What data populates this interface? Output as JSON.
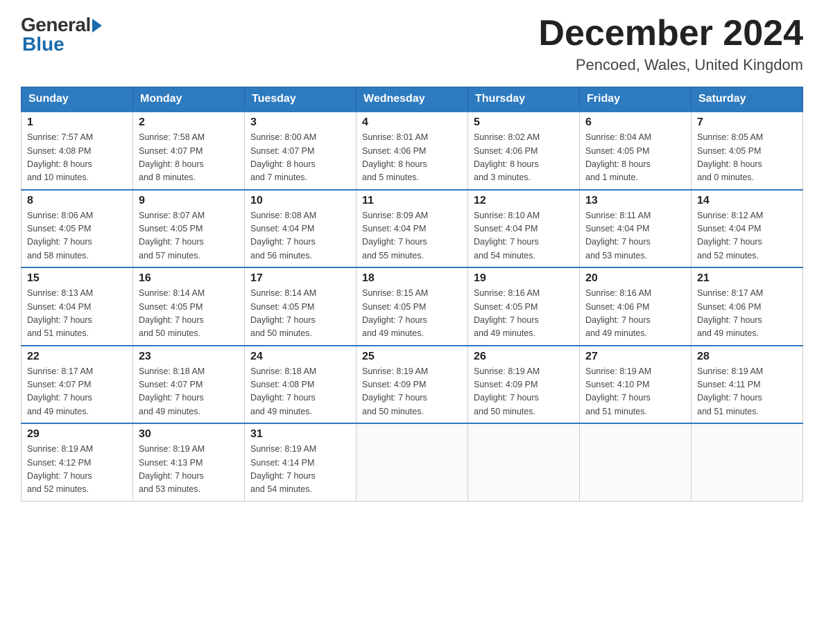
{
  "logo": {
    "general": "General",
    "blue": "Blue"
  },
  "title": "December 2024",
  "subtitle": "Pencoed, Wales, United Kingdom",
  "days_of_week": [
    "Sunday",
    "Monday",
    "Tuesday",
    "Wednesday",
    "Thursday",
    "Friday",
    "Saturday"
  ],
  "weeks": [
    [
      {
        "day": "1",
        "info": "Sunrise: 7:57 AM\nSunset: 4:08 PM\nDaylight: 8 hours\nand 10 minutes."
      },
      {
        "day": "2",
        "info": "Sunrise: 7:58 AM\nSunset: 4:07 PM\nDaylight: 8 hours\nand 8 minutes."
      },
      {
        "day": "3",
        "info": "Sunrise: 8:00 AM\nSunset: 4:07 PM\nDaylight: 8 hours\nand 7 minutes."
      },
      {
        "day": "4",
        "info": "Sunrise: 8:01 AM\nSunset: 4:06 PM\nDaylight: 8 hours\nand 5 minutes."
      },
      {
        "day": "5",
        "info": "Sunrise: 8:02 AM\nSunset: 4:06 PM\nDaylight: 8 hours\nand 3 minutes."
      },
      {
        "day": "6",
        "info": "Sunrise: 8:04 AM\nSunset: 4:05 PM\nDaylight: 8 hours\nand 1 minute."
      },
      {
        "day": "7",
        "info": "Sunrise: 8:05 AM\nSunset: 4:05 PM\nDaylight: 8 hours\nand 0 minutes."
      }
    ],
    [
      {
        "day": "8",
        "info": "Sunrise: 8:06 AM\nSunset: 4:05 PM\nDaylight: 7 hours\nand 58 minutes."
      },
      {
        "day": "9",
        "info": "Sunrise: 8:07 AM\nSunset: 4:05 PM\nDaylight: 7 hours\nand 57 minutes."
      },
      {
        "day": "10",
        "info": "Sunrise: 8:08 AM\nSunset: 4:04 PM\nDaylight: 7 hours\nand 56 minutes."
      },
      {
        "day": "11",
        "info": "Sunrise: 8:09 AM\nSunset: 4:04 PM\nDaylight: 7 hours\nand 55 minutes."
      },
      {
        "day": "12",
        "info": "Sunrise: 8:10 AM\nSunset: 4:04 PM\nDaylight: 7 hours\nand 54 minutes."
      },
      {
        "day": "13",
        "info": "Sunrise: 8:11 AM\nSunset: 4:04 PM\nDaylight: 7 hours\nand 53 minutes."
      },
      {
        "day": "14",
        "info": "Sunrise: 8:12 AM\nSunset: 4:04 PM\nDaylight: 7 hours\nand 52 minutes."
      }
    ],
    [
      {
        "day": "15",
        "info": "Sunrise: 8:13 AM\nSunset: 4:04 PM\nDaylight: 7 hours\nand 51 minutes."
      },
      {
        "day": "16",
        "info": "Sunrise: 8:14 AM\nSunset: 4:05 PM\nDaylight: 7 hours\nand 50 minutes."
      },
      {
        "day": "17",
        "info": "Sunrise: 8:14 AM\nSunset: 4:05 PM\nDaylight: 7 hours\nand 50 minutes."
      },
      {
        "day": "18",
        "info": "Sunrise: 8:15 AM\nSunset: 4:05 PM\nDaylight: 7 hours\nand 49 minutes."
      },
      {
        "day": "19",
        "info": "Sunrise: 8:16 AM\nSunset: 4:05 PM\nDaylight: 7 hours\nand 49 minutes."
      },
      {
        "day": "20",
        "info": "Sunrise: 8:16 AM\nSunset: 4:06 PM\nDaylight: 7 hours\nand 49 minutes."
      },
      {
        "day": "21",
        "info": "Sunrise: 8:17 AM\nSunset: 4:06 PM\nDaylight: 7 hours\nand 49 minutes."
      }
    ],
    [
      {
        "day": "22",
        "info": "Sunrise: 8:17 AM\nSunset: 4:07 PM\nDaylight: 7 hours\nand 49 minutes."
      },
      {
        "day": "23",
        "info": "Sunrise: 8:18 AM\nSunset: 4:07 PM\nDaylight: 7 hours\nand 49 minutes."
      },
      {
        "day": "24",
        "info": "Sunrise: 8:18 AM\nSunset: 4:08 PM\nDaylight: 7 hours\nand 49 minutes."
      },
      {
        "day": "25",
        "info": "Sunrise: 8:19 AM\nSunset: 4:09 PM\nDaylight: 7 hours\nand 50 minutes."
      },
      {
        "day": "26",
        "info": "Sunrise: 8:19 AM\nSunset: 4:09 PM\nDaylight: 7 hours\nand 50 minutes."
      },
      {
        "day": "27",
        "info": "Sunrise: 8:19 AM\nSunset: 4:10 PM\nDaylight: 7 hours\nand 51 minutes."
      },
      {
        "day": "28",
        "info": "Sunrise: 8:19 AM\nSunset: 4:11 PM\nDaylight: 7 hours\nand 51 minutes."
      }
    ],
    [
      {
        "day": "29",
        "info": "Sunrise: 8:19 AM\nSunset: 4:12 PM\nDaylight: 7 hours\nand 52 minutes."
      },
      {
        "day": "30",
        "info": "Sunrise: 8:19 AM\nSunset: 4:13 PM\nDaylight: 7 hours\nand 53 minutes."
      },
      {
        "day": "31",
        "info": "Sunrise: 8:19 AM\nSunset: 4:14 PM\nDaylight: 7 hours\nand 54 minutes."
      },
      {
        "day": "",
        "info": ""
      },
      {
        "day": "",
        "info": ""
      },
      {
        "day": "",
        "info": ""
      },
      {
        "day": "",
        "info": ""
      }
    ]
  ]
}
